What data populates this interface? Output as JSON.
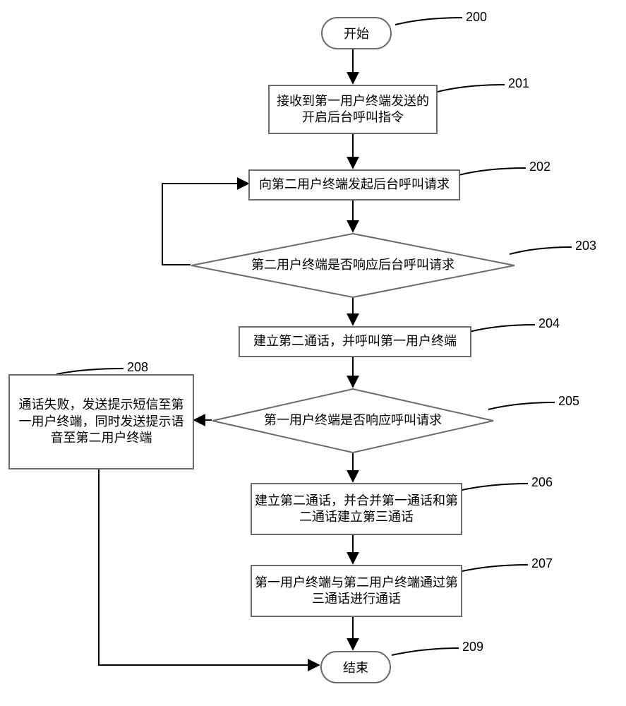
{
  "chart_data": {
    "type": "flowchart",
    "title": "",
    "nodes": [
      {
        "id": "200",
        "type": "terminator",
        "text": "开始"
      },
      {
        "id": "201",
        "type": "process",
        "text": "接收到第一用户终端发送的开启后台呼叫指令"
      },
      {
        "id": "202",
        "type": "process",
        "text": "向第二用户终端发起后台呼叫请求"
      },
      {
        "id": "203",
        "type": "decision",
        "text": "第二用户终端是否响应后台呼叫请求"
      },
      {
        "id": "204",
        "type": "process",
        "text": "建立第二通话，并呼叫第一用户终端"
      },
      {
        "id": "205",
        "type": "decision",
        "text": "第一用户终端是否响应呼叫请求"
      },
      {
        "id": "206",
        "type": "process",
        "text": "建立第二通话，并合并第一通话和第二通话建立第三通话"
      },
      {
        "id": "207",
        "type": "process",
        "text": "第一用户终端与第二用户终端通过第三通话进行通话"
      },
      {
        "id": "208",
        "type": "process",
        "text": "通话失败，发送提示短信至第一用户终端，同时发送提示语音至第二用户终端"
      },
      {
        "id": "209",
        "type": "terminator",
        "text": "结束"
      }
    ],
    "edges": [
      {
        "from": "200",
        "to": "201"
      },
      {
        "from": "201",
        "to": "202"
      },
      {
        "from": "202",
        "to": "203"
      },
      {
        "from": "203",
        "to": "204",
        "label": ""
      },
      {
        "from": "203",
        "to": "202",
        "label": "",
        "note": "no (loop back left)"
      },
      {
        "from": "204",
        "to": "205"
      },
      {
        "from": "205",
        "to": "206",
        "label": ""
      },
      {
        "from": "205",
        "to": "208",
        "label": "",
        "note": "no (left)"
      },
      {
        "from": "206",
        "to": "207"
      },
      {
        "from": "207",
        "to": "209"
      },
      {
        "from": "208",
        "to": "209"
      }
    ]
  },
  "nodes": {
    "200": "开始",
    "201": "接收到第一用户终端发送的开启后台呼叫指令",
    "202": "向第二用户终端发起后台呼叫请求",
    "203": "第二用户终端是否响应后台呼叫请求",
    "204": "建立第二通话，并呼叫第一用户终端",
    "205": "第一用户终端是否响应呼叫请求",
    "206": "建立第二通话，并合并第一通话和第二通话建立第三通话",
    "207": "第一用户终端与第二用户终端通过第三通话进行通话",
    "208": "通话失败，发送提示短信至第一用户终端，同时发送提示语音至第二用户终端",
    "209": "结束"
  },
  "refs": {
    "200": "200",
    "201": "201",
    "202": "202",
    "203": "203",
    "204": "204",
    "205": "205",
    "206": "206",
    "207": "207",
    "208": "208",
    "209": "209"
  }
}
